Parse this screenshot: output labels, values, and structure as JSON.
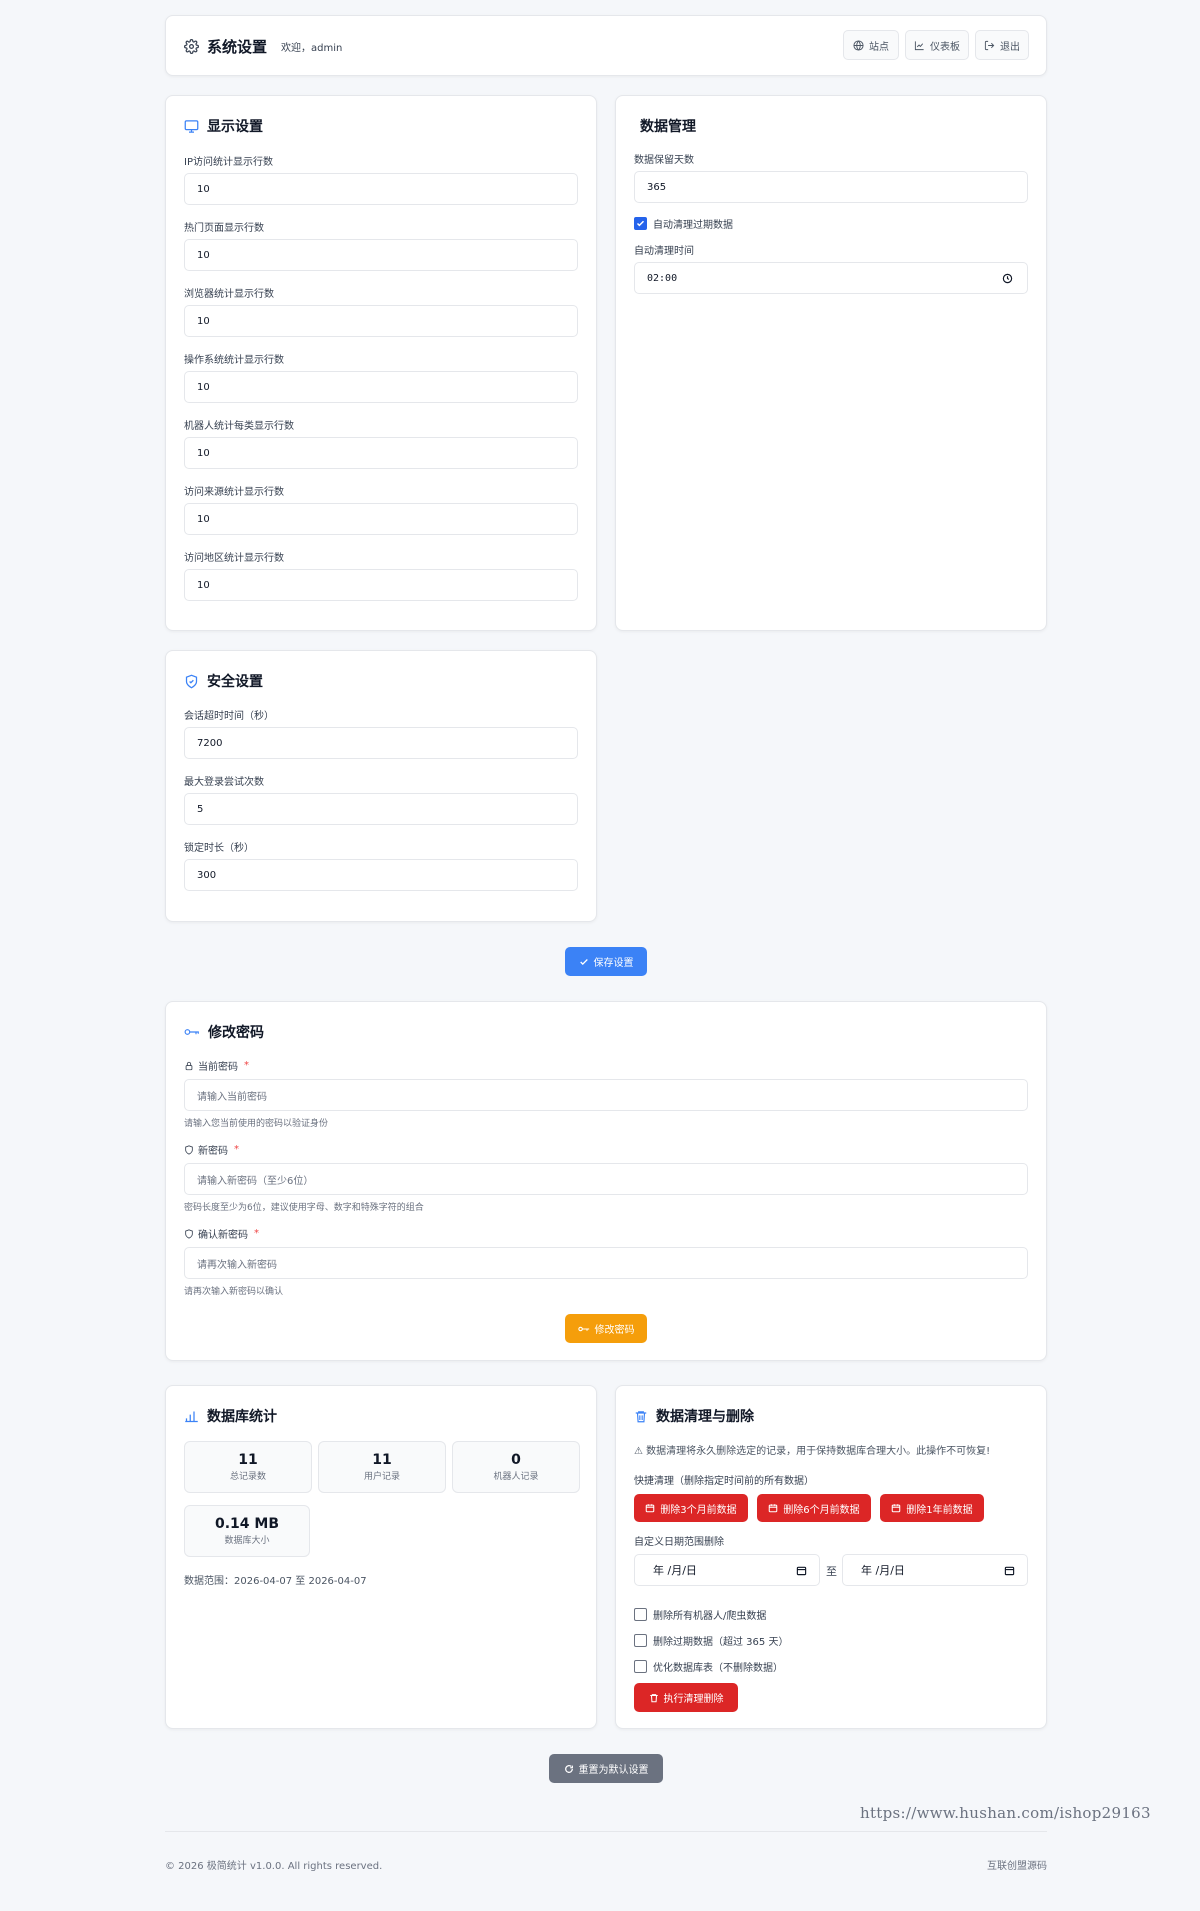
{
  "header": {
    "title": "系统设置",
    "welcome": "欢迎，admin",
    "buttons": {
      "site": "站点",
      "dashboard": "仪表板",
      "logout": "退出"
    }
  },
  "display_settings": {
    "title": "显示设置",
    "fields": [
      {
        "label": "IP访问统计显示行数",
        "value": "10"
      },
      {
        "label": "热门页面显示行数",
        "value": "10"
      },
      {
        "label": "浏览器统计显示行数",
        "value": "10"
      },
      {
        "label": "操作系统统计显示行数",
        "value": "10"
      },
      {
        "label": "机器人统计每类显示行数",
        "value": "10"
      },
      {
        "label": "访问来源统计显示行数",
        "value": "10"
      },
      {
        "label": "访问地区统计显示行数",
        "value": "10"
      }
    ]
  },
  "data_management": {
    "title": "数据管理",
    "retention_label": "数据保留天数",
    "retention_value": "365",
    "auto_cleanup_label": "自动清理过期数据",
    "auto_cleanup_checked": true,
    "cleanup_time_label": "自动清理时间",
    "cleanup_time_value": "02:00"
  },
  "security_settings": {
    "title": "安全设置",
    "fields": [
      {
        "label": "会话超时时间（秒）",
        "value": "7200"
      },
      {
        "label": "最大登录尝试次数",
        "value": "5"
      },
      {
        "label": "锁定时长（秒）",
        "value": "300"
      }
    ]
  },
  "save_button": "保存设置",
  "change_password": {
    "title": "修改密码",
    "required_mark": "*",
    "current": {
      "label": "当前密码",
      "placeholder": "请输入当前密码",
      "hint": "请输入您当前使用的密码以验证身份"
    },
    "new": {
      "label": "新密码",
      "placeholder": "请输入新密码（至少6位）",
      "hint": "密码长度至少为6位，建议使用字母、数字和特殊字符的组合"
    },
    "confirm": {
      "label": "确认新密码",
      "placeholder": "请再次输入新密码",
      "hint": "请再次输入新密码以确认"
    },
    "submit": "修改密码"
  },
  "db_stats": {
    "title": "数据库统计",
    "stats": [
      {
        "value": "11",
        "label": "总记录数"
      },
      {
        "value": "11",
        "label": "用户记录"
      },
      {
        "value": "0",
        "label": "机器人记录"
      }
    ],
    "size": {
      "value": "0.14 MB",
      "label": "数据库大小"
    },
    "range": "数据范围：2026-04-07 至 2026-04-07"
  },
  "cleanup": {
    "title": "数据清理与删除",
    "warning": "⚠ 数据清理将永久删除选定的记录，用于保持数据库合理大小。此操作不可恢复!",
    "quick_label": "快捷清理（删除指定时间前的所有数据）",
    "quick_buttons": [
      "删除3个月前数据",
      "删除6个月前数据",
      "删除1年前数据"
    ],
    "custom_label": "自定义日期范围删除",
    "date_placeholder": "年 /月/日",
    "to": "至",
    "options": [
      {
        "label": "删除所有机器人/爬虫数据",
        "checked": false
      },
      {
        "label": "删除过期数据（超过 365 天）",
        "checked": false
      },
      {
        "label": "优化数据库表（不删除数据）",
        "checked": false
      }
    ],
    "execute": "执行清理删除"
  },
  "reset_button": "重置为默认设置",
  "watermark": "https://www.hushan.com/ishop29163",
  "footer": {
    "copyright": "© 2026 极简统计 v1.0.0. All rights reserved.",
    "link": "互联创盟源码"
  },
  "colors": {
    "primary": "#3b82f6",
    "warning": "#f59e0b",
    "danger": "#dc2626",
    "gray": "#6b7280"
  }
}
